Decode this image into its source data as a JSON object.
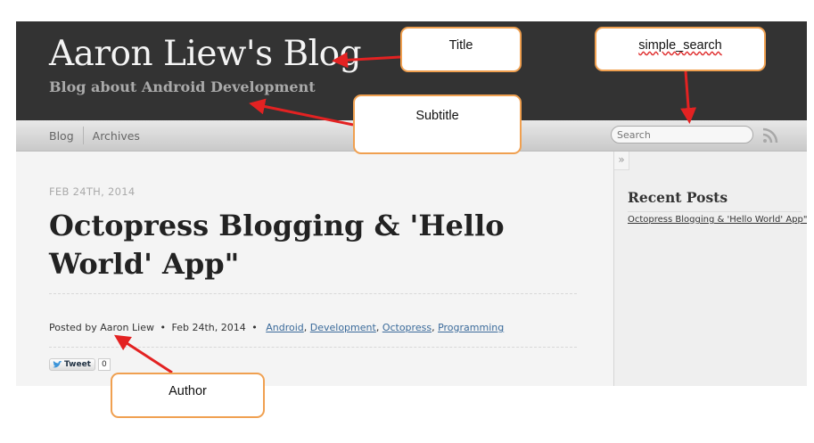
{
  "blog": {
    "title": "Aaron Liew's Blog",
    "subtitle": "Blog about Android Development",
    "nav": {
      "blog": "Blog",
      "archives": "Archives"
    },
    "search_placeholder": "Search"
  },
  "post": {
    "date": "Feb 24th, 2014",
    "title": "Octopress Blogging & 'Hello World' App\"",
    "posted_by_prefix": "Posted by",
    "author": "Aaron Liew",
    "bullet": "•",
    "meta_date": "Feb 24th, 2014",
    "categories": [
      "Android",
      "Development",
      "Octopress",
      "Programming"
    ],
    "tweet_label": "Tweet",
    "tweet_count": "0"
  },
  "sidebar": {
    "collapse_glyph": "»",
    "recent_heading": "Recent Posts",
    "recent_posts": [
      "Octopress Blogging & 'Hello World' App\""
    ]
  },
  "annotations": {
    "title": "Title",
    "simple_search": "simple_search",
    "subtitle": "Subtitle",
    "author": "Author"
  },
  "colors": {
    "header_bg": "#333333",
    "callout_border": "#f0a050",
    "arrow": "#e32222",
    "link": "#3a6a9a"
  },
  "icons": {
    "rss": "rss-icon",
    "twitter": "twitter-bird-icon"
  }
}
